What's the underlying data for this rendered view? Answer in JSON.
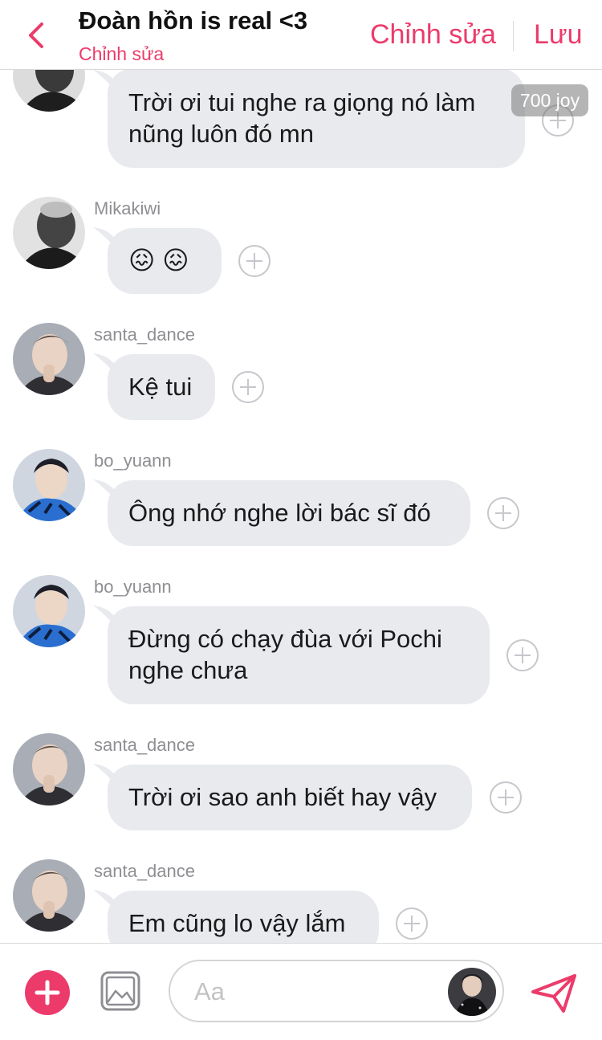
{
  "header": {
    "title": "Đoàn hồn is real <3",
    "subtitle": "Chỉnh sửa",
    "edit_label": "Chỉnh sửa",
    "save_label": "Lưu",
    "accent": "#ec3b6b"
  },
  "joy_badge": "700 joy",
  "messages": [
    {
      "author": "",
      "avatar": "mikakiwi",
      "lines": [
        "Trời ơi tui nghe ra giọng nó làm",
        "nũng luôn đó mn"
      ]
    },
    {
      "author": "Mikakiwi",
      "avatar": "mikakiwi",
      "lines": [
        "😖 😖"
      ]
    },
    {
      "author": "santa_dance",
      "avatar": "santa",
      "lines": [
        "Kệ tui"
      ]
    },
    {
      "author": "bo_yuann",
      "avatar": "boyuann",
      "lines": [
        "Ông nhớ nghe lời bác sĩ đó"
      ]
    },
    {
      "author": "bo_yuann",
      "avatar": "boyuann",
      "lines": [
        "Đừng có chạy đùa với Pochi",
        "nghe chưa"
      ]
    },
    {
      "author": "santa_dance",
      "avatar": "santa",
      "lines": [
        "Trời ơi sao anh biết hay vậy"
      ]
    },
    {
      "author": "santa_dance",
      "avatar": "santa",
      "lines": [
        "Em cũng lo vậy lắm"
      ]
    }
  ],
  "composer": {
    "placeholder": "Aa"
  },
  "colors": {
    "bubble": "#e8eaee",
    "username": "#8e8e93",
    "accent": "#ec3b6b"
  }
}
